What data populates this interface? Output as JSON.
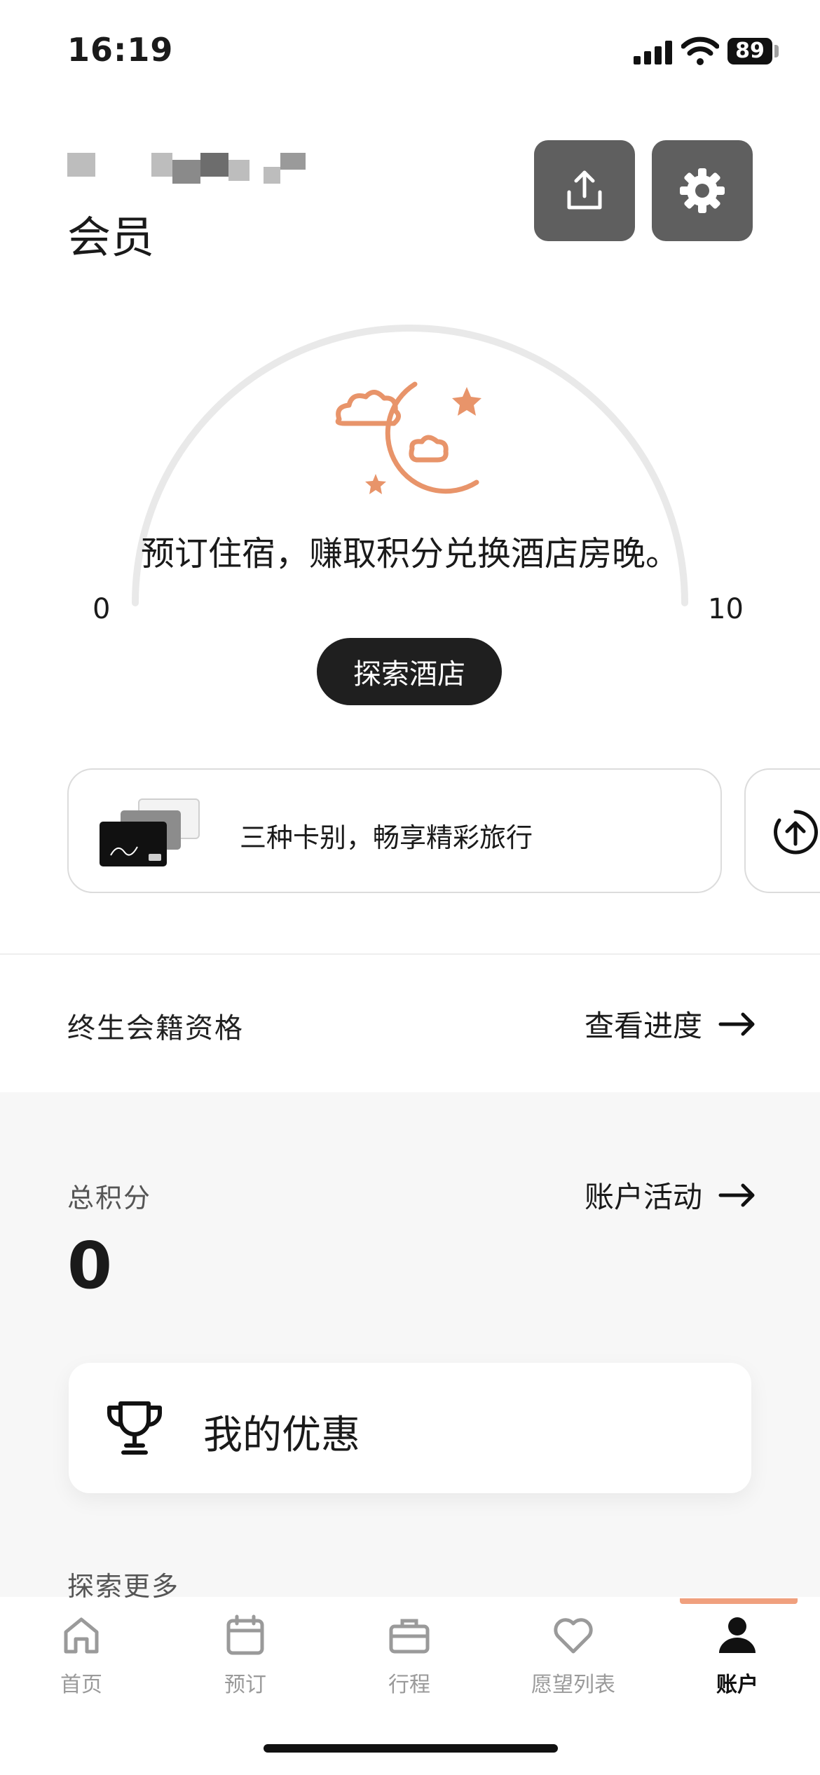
{
  "status_bar": {
    "time": "16:19",
    "battery": "89"
  },
  "header": {
    "tier": "会员",
    "share_icon": "share-icon",
    "settings_icon": "gear-icon"
  },
  "gauge": {
    "message": "预订住宿，赚取积分兑换酒店房晚。",
    "min": "0",
    "max": "10",
    "progress_fraction": 0,
    "cta": "探索酒店",
    "accent_color": "#e8946a"
  },
  "card_banner": {
    "text": "三种卡别，畅享精彩旅行"
  },
  "lifetime": {
    "label": "终生会籍资格",
    "link": "查看进度"
  },
  "points": {
    "label": "总积分",
    "value": "0",
    "link": "账户活动"
  },
  "offers": {
    "label": "我的优惠"
  },
  "explore_more": {
    "label": "探索更多"
  },
  "tabs": [
    {
      "label": "首页",
      "icon": "home-icon"
    },
    {
      "label": "预订",
      "icon": "calendar-icon"
    },
    {
      "label": "行程",
      "icon": "briefcase-icon"
    },
    {
      "label": "愿望列表",
      "icon": "heart-icon"
    },
    {
      "label": "账户",
      "icon": "account-icon",
      "active": true
    }
  ]
}
